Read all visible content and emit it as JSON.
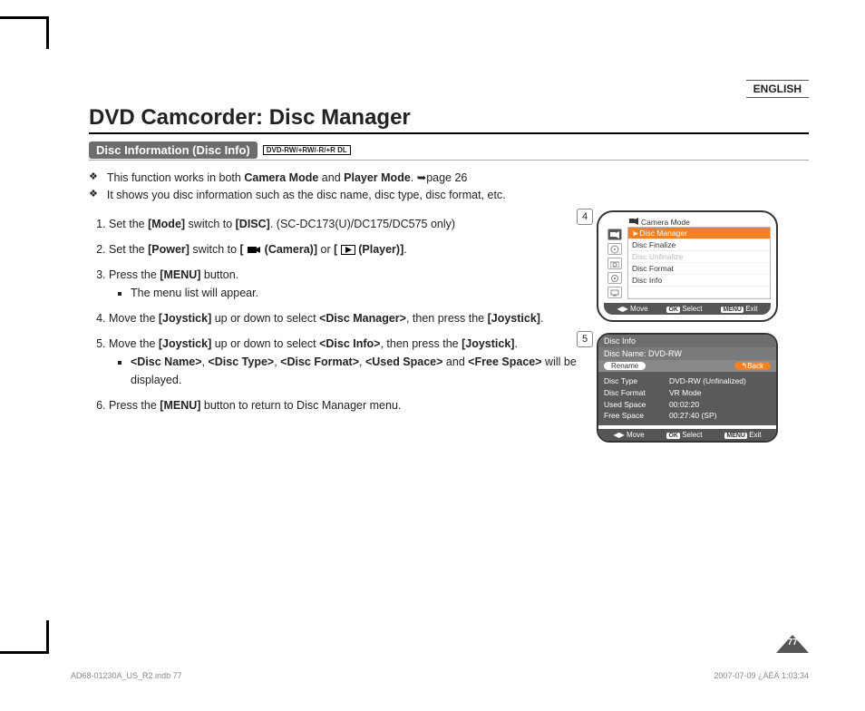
{
  "lang": "ENGLISH",
  "title": "DVD Camcorder: Disc Manager",
  "section": {
    "label": "Disc Information (Disc Info)",
    "discs": "DVD-RW/+RW/-R/+R DL"
  },
  "intro": {
    "line1_a": "This function works in both ",
    "line1_b": "Camera Mode",
    "line1_c": " and ",
    "line1_d": "Player Mode",
    "line1_e": ". ➥page 26",
    "line2": "It shows you disc information such as the disc name, disc type, disc format, etc."
  },
  "steps": {
    "s1_a": "Set the ",
    "s1_b": "[Mode]",
    "s1_c": " switch to ",
    "s1_d": "[DISC]",
    "s1_e": ". (SC-DC173(U)/DC175/DC575 only)",
    "s2_a": "Set the ",
    "s2_b": "[Power]",
    "s2_c": " switch to ",
    "s2_d": "[",
    "s2_e": "(Camera)]",
    "s2_f": " or ",
    "s2_g": "[",
    "s2_h": "(Player)]",
    "s2_i": ".",
    "s3_a": "Press the ",
    "s3_b": "[MENU]",
    "s3_c": " button.",
    "s3_sub": "The menu list will appear.",
    "s4_a": "Move the ",
    "s4_b": "[Joystick]",
    "s4_c": " up or down to select ",
    "s4_d": "<Disc Manager>",
    "s4_e": ", then press the ",
    "s4_f": "[Joystick]",
    "s4_g": ".",
    "s5_a": "Move the ",
    "s5_b": "[Joystick]",
    "s5_c": " up or down to select ",
    "s5_d": "<Disc Info>",
    "s5_e": ", then press the ",
    "s5_f": "[Joystick]",
    "s5_g": ".",
    "s5_sub_a": "<Disc Name>",
    "s5_sub_b": ", ",
    "s5_sub_c": "<Disc Type>",
    "s5_sub_d": ", ",
    "s5_sub_e": "<Disc Format>",
    "s5_sub_f": ", ",
    "s5_sub_g": "<Used Space>",
    "s5_sub_h": " and ",
    "s5_sub_i": "<Free Space>",
    "s5_sub_j": " will be displayed.",
    "s6_a": "Press the ",
    "s6_b": "[MENU]",
    "s6_c": " button to return to Disc Manager menu."
  },
  "fig4": {
    "num": "4",
    "head": "Camera Mode",
    "items": [
      "Disc Manager",
      "Disc Finalize",
      "Disc Unfinalize",
      "Disc Format",
      "Disc Info"
    ],
    "footer": {
      "move": "Move",
      "select": "Select",
      "exit": "Exit",
      "ok": "OK",
      "menu": "MENU"
    }
  },
  "fig5": {
    "num": "5",
    "title": "Disc Info",
    "discname_label": "Disc Name: DVD-RW",
    "rename": "Rename",
    "back": "↰Back",
    "rows": [
      {
        "k": "Disc Type",
        "v": "DVD-RW (Unfinalized)"
      },
      {
        "k": "Disc Format",
        "v": "VR Mode"
      },
      {
        "k": "Used Space",
        "v": "00:02:20"
      },
      {
        "k": "Free Space",
        "v": "00:27:40 (SP)"
      }
    ],
    "footer": {
      "move": "Move",
      "select": "Select",
      "exit": "Exit",
      "ok": "OK",
      "menu": "MENU"
    }
  },
  "pagenum": "77",
  "doc_footer": {
    "left": "AD68-01230A_US_R2.indb   77",
    "right": "2007-07-09   ¿ÀÈÄ 1:03:34"
  }
}
